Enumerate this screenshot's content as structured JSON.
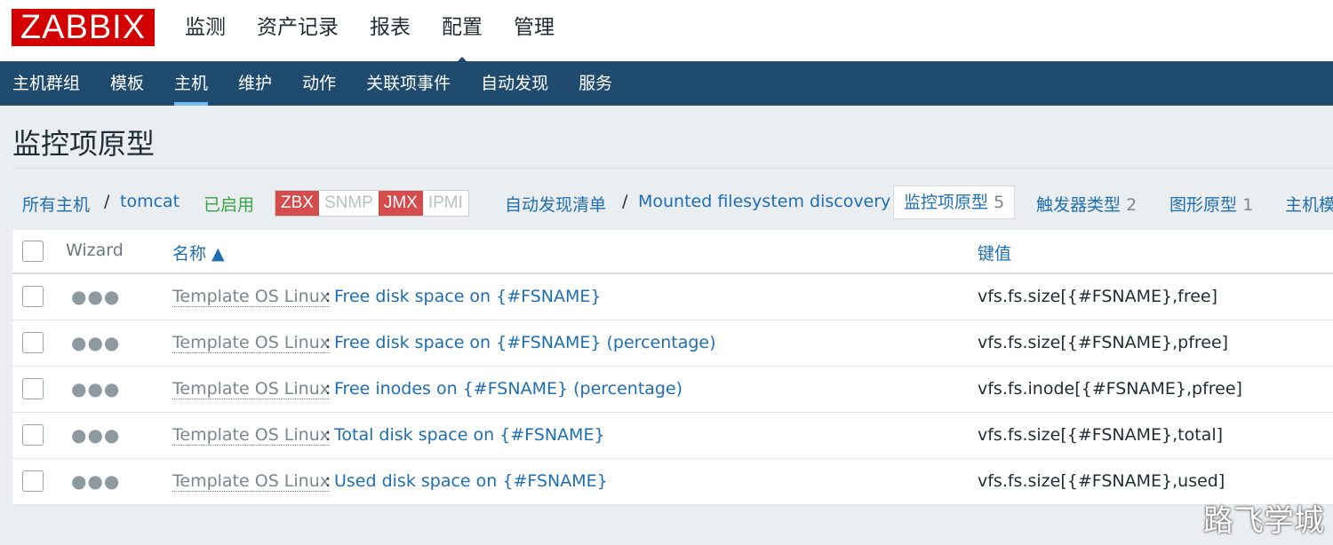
{
  "logo": "ZABBIX",
  "top_nav": [
    "监测",
    "资产记录",
    "报表",
    "配置",
    "管理"
  ],
  "sub_nav": [
    "主机群组",
    "模板",
    "主机",
    "维护",
    "动作",
    "关联项事件",
    "自动发现",
    "服务"
  ],
  "page_title": "监控项原型",
  "breadcrumb": {
    "all_hosts": "所有主机",
    "sep": "/",
    "host": "tomcat",
    "status": "已启用",
    "availability": [
      "ZBX",
      "SNMP",
      "JMX",
      "IPMI"
    ],
    "discovery_list": "自动发现清单",
    "discovery_rule": "Mounted filesystem discovery",
    "item_prototypes": {
      "label": "监控项原型",
      "count": "5"
    },
    "trigger_prototypes": {
      "label": "触发器类型",
      "count": "2"
    },
    "graph_prototypes": {
      "label": "图形原型",
      "count": "1"
    },
    "host_prototypes_partial": "主机模"
  },
  "table": {
    "headers": {
      "wizard": "Wizard",
      "name": "名称 ▲",
      "key": "键值"
    },
    "rows": [
      {
        "template": "Template OS Linux",
        "sep": ":",
        "name": "Free disk space on {#FSNAME}",
        "key": "vfs.fs.size[{#FSNAME},free]"
      },
      {
        "template": "Template OS Linux",
        "sep": ":",
        "name": "Free disk space on {#FSNAME} (percentage)",
        "key": "vfs.fs.size[{#FSNAME},pfree]"
      },
      {
        "template": "Template OS Linux",
        "sep": ":",
        "name": "Free inodes on {#FSNAME} (percentage)",
        "key": "vfs.fs.inode[{#FSNAME},pfree]"
      },
      {
        "template": "Template OS Linux",
        "sep": ":",
        "name": "Total disk space on {#FSNAME}",
        "key": "vfs.fs.size[{#FSNAME},total]"
      },
      {
        "template": "Template OS Linux",
        "sep": ":",
        "name": "Used disk space on {#FSNAME}",
        "key": "vfs.fs.size[{#FSNAME},used]"
      }
    ],
    "row_menu_icon": "ellipsis-icon"
  },
  "watermark": "路飞学城",
  "colors": {
    "brand": "#d40000",
    "subnav": "#1f4b6e",
    "link": "#1e6eb4",
    "enabled": "#3aa246",
    "badge_on": "#d44c4c"
  }
}
